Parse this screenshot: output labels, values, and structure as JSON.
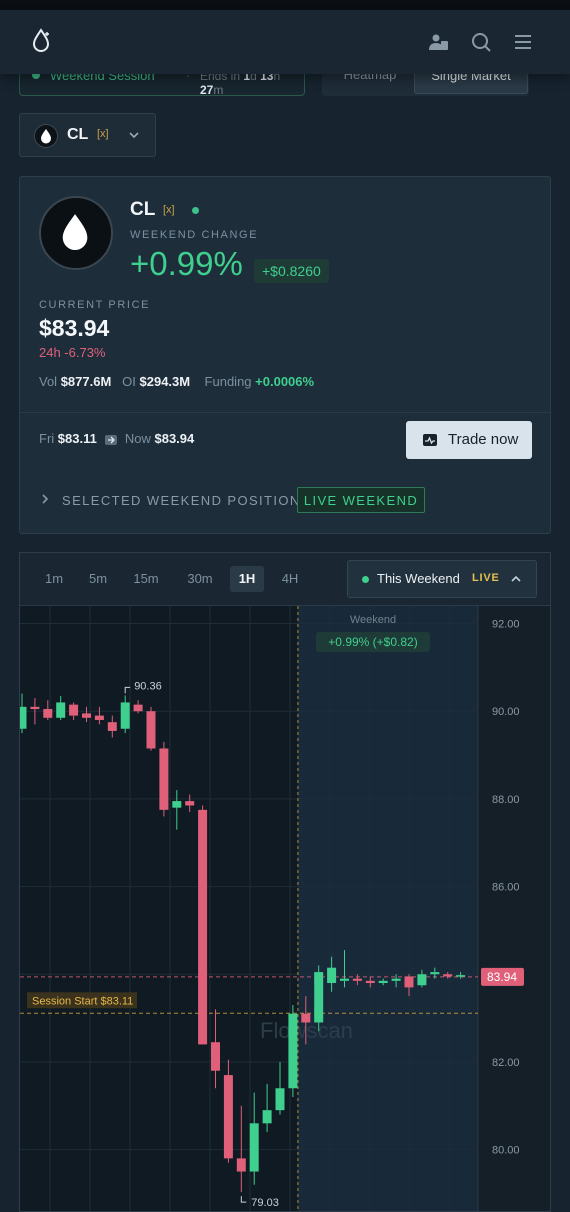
{
  "header": {
    "logo": "droplet-logo",
    "icons": [
      "users-icon",
      "search-icon",
      "menu-icon"
    ]
  },
  "session": {
    "label": "Weekend Session",
    "ends_prefix": "Ends in",
    "days": "1",
    "d_unit": "d",
    "hours": "13",
    "h_unit": "h",
    "minutes": "27",
    "m_unit": "m"
  },
  "view_tabs": [
    "Heatmap",
    "Single Market"
  ],
  "market_select": {
    "symbol": "CL",
    "tag": "[x]"
  },
  "summary": {
    "symbol": "CL",
    "tag": "[x]",
    "weekend_change_label": "WEEKEND CHANGE",
    "weekend_change_pct": "+0.99%",
    "weekend_change_abs": "+$0.8260",
    "current_price_label": "CURRENT PRICE",
    "current_price": "$83.94",
    "change_24h": "24h -6.73%",
    "vol_label": "Vol",
    "vol": "$877.6M",
    "oi_label": "OI",
    "oi": "$294.3M",
    "funding_label": "Funding",
    "funding": "+0.0006%",
    "fri_label": "Fri",
    "fri_price": "$83.11",
    "now_label": "Now",
    "now_price": "$83.94",
    "trade_button": "Trade now",
    "positions_label": "SELECTED WEEKEND POSITIONS",
    "live_badge": "LIVE WEEKEND"
  },
  "timeframes": [
    "1m",
    "5m",
    "15m",
    "30m",
    "1H",
    "4H"
  ],
  "active_timeframe": "1H",
  "range_selector": {
    "label": "This Weekend",
    "live": "LIVE"
  },
  "colors": {
    "up": "#3fcf8e",
    "down": "#e0607a",
    "accent_gold": "#d8a940",
    "background": "#172430"
  },
  "chart_data": {
    "type": "candlestick",
    "y_ticks": [
      "92.00",
      "90.00",
      "88.00",
      "86.00",
      "84.00",
      "82.00",
      "80.00"
    ],
    "ylim": [
      78.6,
      92.4
    ],
    "candles": [
      {
        "o": 89.6,
        "h": 90.4,
        "l": 89.5,
        "c": 90.1
      },
      {
        "o": 90.1,
        "h": 90.3,
        "l": 89.7,
        "c": 90.05
      },
      {
        "o": 90.05,
        "h": 90.25,
        "l": 89.8,
        "c": 89.85
      },
      {
        "o": 89.85,
        "h": 90.35,
        "l": 89.8,
        "c": 90.2
      },
      {
        "o": 90.15,
        "h": 90.2,
        "l": 89.8,
        "c": 89.9
      },
      {
        "o": 89.95,
        "h": 90.1,
        "l": 89.75,
        "c": 89.85
      },
      {
        "o": 89.9,
        "h": 90.1,
        "l": 89.7,
        "c": 89.8
      },
      {
        "o": 89.75,
        "h": 89.9,
        "l": 89.4,
        "c": 89.55
      },
      {
        "o": 89.6,
        "h": 90.36,
        "l": 89.5,
        "c": 90.2
      },
      {
        "o": 90.15,
        "h": 90.25,
        "l": 89.95,
        "c": 90.0
      },
      {
        "o": 90.0,
        "h": 90.1,
        "l": 89.1,
        "c": 89.15
      },
      {
        "o": 89.15,
        "h": 89.3,
        "l": 87.6,
        "c": 87.75
      },
      {
        "o": 87.8,
        "h": 88.2,
        "l": 87.3,
        "c": 87.95
      },
      {
        "o": 87.95,
        "h": 88.1,
        "l": 87.7,
        "c": 87.85
      },
      {
        "o": 87.75,
        "h": 87.85,
        "l": 82.4,
        "c": 82.4
      },
      {
        "o": 82.45,
        "h": 83.2,
        "l": 81.4,
        "c": 81.8
      },
      {
        "o": 81.7,
        "h": 82.05,
        "l": 79.7,
        "c": 79.8
      },
      {
        "o": 79.8,
        "h": 81.0,
        "l": 79.03,
        "c": 79.5
      },
      {
        "o": 79.5,
        "h": 81.3,
        "l": 79.2,
        "c": 80.6
      },
      {
        "o": 80.6,
        "h": 81.5,
        "l": 80.4,
        "c": 80.9
      },
      {
        "o": 80.9,
        "h": 82.0,
        "l": 80.8,
        "c": 81.4
      },
      {
        "o": 81.4,
        "h": 83.3,
        "l": 81.2,
        "c": 83.1
      },
      {
        "o": 83.1,
        "h": 83.5,
        "l": 82.4,
        "c": 82.9
      },
      {
        "o": 82.9,
        "h": 84.2,
        "l": 82.7,
        "c": 84.05
      },
      {
        "o": 83.8,
        "h": 84.4,
        "l": 83.6,
        "c": 84.15
      },
      {
        "o": 83.85,
        "h": 84.55,
        "l": 83.7,
        "c": 83.9
      },
      {
        "o": 83.9,
        "h": 84.0,
        "l": 83.75,
        "c": 83.85
      },
      {
        "o": 83.85,
        "h": 83.95,
        "l": 83.7,
        "c": 83.8
      },
      {
        "o": 83.8,
        "h": 83.9,
        "l": 83.75,
        "c": 83.85
      },
      {
        "o": 83.85,
        "h": 84.0,
        "l": 83.7,
        "c": 83.9
      },
      {
        "o": 83.95,
        "h": 84.0,
        "l": 83.5,
        "c": 83.7
      },
      {
        "o": 83.75,
        "h": 84.1,
        "l": 83.7,
        "c": 84.0
      },
      {
        "o": 84.0,
        "h": 84.15,
        "l": 83.9,
        "c": 84.05
      },
      {
        "o": 84.0,
        "h": 84.05,
        "l": 83.9,
        "c": 83.95
      },
      {
        "o": 83.95,
        "h": 84.05,
        "l": 83.9,
        "c": 83.98
      }
    ],
    "weekend_start_index": 21,
    "session_start_price": 83.11,
    "session_start_label": "Session Start $83.11",
    "current_price": 83.94,
    "current_price_label": "83.94",
    "high_label": "90.36",
    "high_index": 8,
    "low_label": "79.03",
    "low_index": 17,
    "weekend_label": "Weekend",
    "weekend_change_label": "+0.99% (+$0.82)",
    "watermark": "Flowscan"
  }
}
